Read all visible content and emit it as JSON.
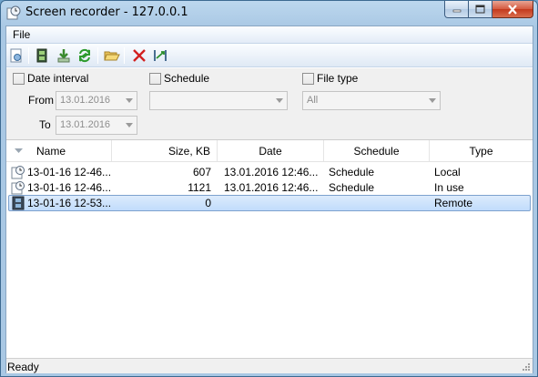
{
  "window": {
    "title": "Screen recorder - 127.0.0.1"
  },
  "menu": {
    "file": "File"
  },
  "toolbar": {
    "icons": [
      "properties-icon",
      "film-icon",
      "download-icon",
      "refresh-icon",
      "open-folder-icon",
      "delete-icon",
      "merge-icon"
    ]
  },
  "filters": {
    "date_interval_label": "Date interval",
    "from_label": "From",
    "from_value": "13.01.2016",
    "to_label": "To",
    "to_value": "13.01.2016",
    "schedule_label": "Schedule",
    "schedule_value": "",
    "file_type_label": "File type",
    "file_type_value": "All"
  },
  "list": {
    "columns": {
      "name": "Name",
      "size": "Size, KB",
      "date": "Date",
      "schedule": "Schedule",
      "type": "Type"
    },
    "rows": [
      {
        "icon": "clock-file-icon",
        "name": "13-01-16 12-46...",
        "size": "607",
        "date": "13.01.2016 12:46...",
        "schedule": "Schedule",
        "type": "Local"
      },
      {
        "icon": "clock-file-icon",
        "name": "13-01-16 12-46...",
        "size": "1121",
        "date": "13.01.2016 12:46...",
        "schedule": "Schedule",
        "type": "In use"
      },
      {
        "icon": "film-icon",
        "name": "13-01-16 12-53...",
        "size": "0",
        "date": "",
        "schedule": "",
        "type": "Remote"
      }
    ]
  },
  "status": {
    "text": "Ready"
  },
  "colors": {
    "selection": "#c1dcfc",
    "accent": "#7da2ce",
    "delete": "#d22020"
  }
}
